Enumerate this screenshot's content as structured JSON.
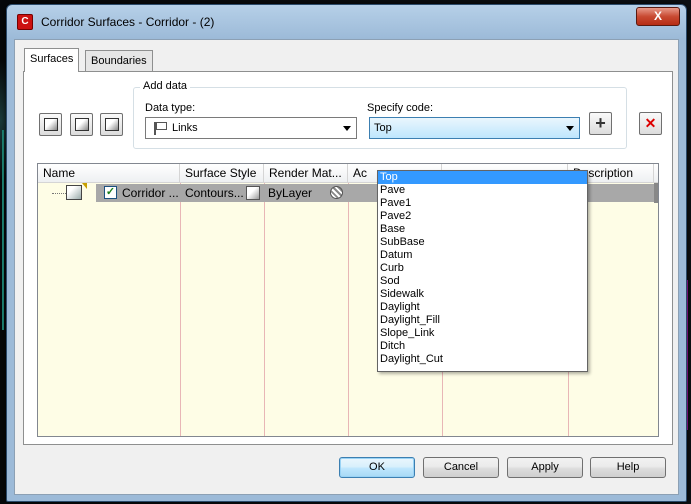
{
  "window": {
    "title": "Corridor Surfaces - Corridor - (2)",
    "close_glyph": "X",
    "app_icon_glyph": "C"
  },
  "tabs": [
    {
      "label": "Surfaces",
      "active": true
    },
    {
      "label": "Boundaries",
      "active": false
    }
  ],
  "toolbar": {
    "icons": [
      "create-surface-icon",
      "create-surface-from-links-icon",
      "pick-surface-icon"
    ]
  },
  "add_data": {
    "group_label": "Add data",
    "data_type_label": "Data type:",
    "data_type_value": "Links",
    "specify_code_label": "Specify code:",
    "specify_code_value": "Top",
    "add_glyph": "+",
    "delete_glyph": "✕"
  },
  "code_options": [
    "Top",
    "Pave",
    "Pave1",
    "Pave2",
    "Base",
    "SubBase",
    "Datum",
    "Curb",
    "Sod",
    "Sidewalk",
    "Daylight",
    "Daylight_Fill",
    "Slope_Link",
    "Ditch",
    "Daylight_Cut"
  ],
  "grid": {
    "columns": [
      "Name",
      "Surface Style",
      "Render Mat...",
      "Ac",
      "Description"
    ],
    "rows": [
      {
        "checked_glyph": "✓",
        "name": "Corridor ...",
        "style": "Contours...",
        "material": "ByLayer"
      }
    ]
  },
  "buttons": {
    "ok": "OK",
    "cancel": "Cancel",
    "apply": "Apply",
    "help": "Help"
  },
  "colors": {
    "selection": "#3399ff",
    "grid_bg": "#fefde6",
    "delete_red": "#dd0000"
  }
}
